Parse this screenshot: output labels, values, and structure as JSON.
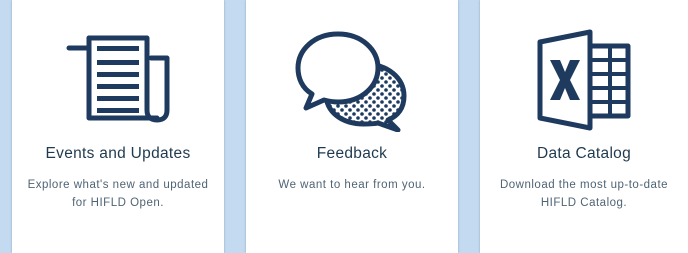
{
  "colors": {
    "background": "#c3daf1",
    "card": "#ffffff",
    "icon": "#1f3a5f",
    "title": "#1f3a4f",
    "text": "#4f6474"
  },
  "cards": [
    {
      "icon": "newspaper-icon",
      "title": "Events and Updates",
      "description": "Explore what's new and updated for HIFLD Open."
    },
    {
      "icon": "speech-bubbles-icon",
      "title": "Feedback",
      "description": "We want to hear from you."
    },
    {
      "icon": "excel-spreadsheet-icon",
      "title": "Data Catalog",
      "description": "Download the most up-to-date HIFLD Catalog."
    }
  ]
}
